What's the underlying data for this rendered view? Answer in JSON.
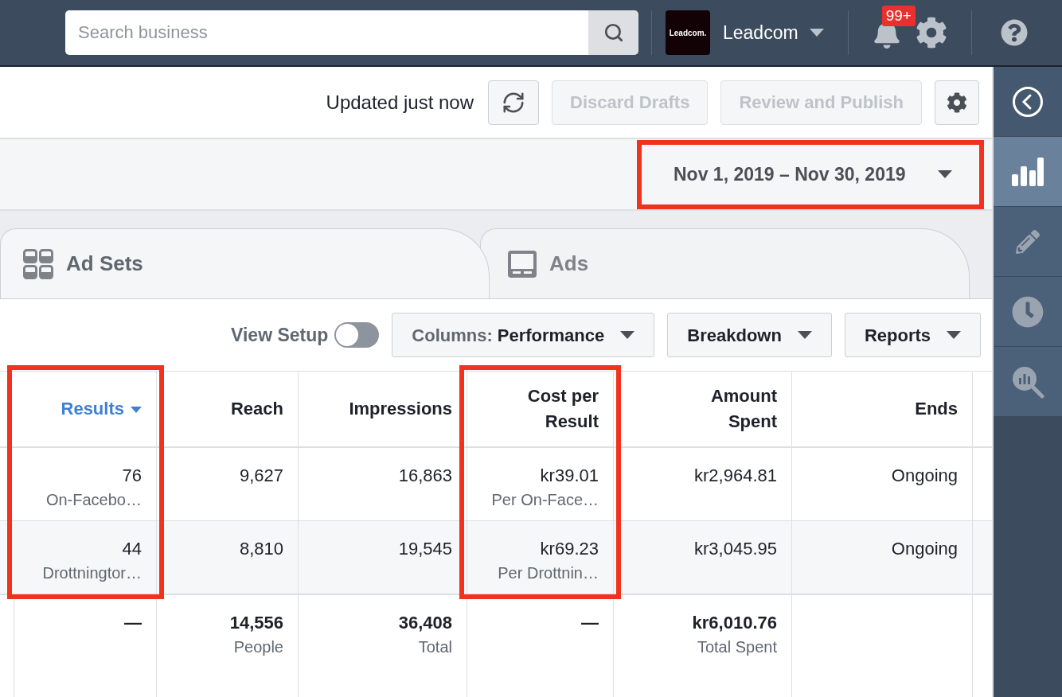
{
  "top_bar": {
    "search": {
      "placeholder": "Search business"
    },
    "account": {
      "logo_text": "Leadcom.",
      "name": "Leadcom"
    },
    "notifications": {
      "badge": "99+"
    }
  },
  "toolbar": {
    "status": "Updated just now",
    "buttons": [
      {
        "label": "Discard Drafts",
        "disabled": true
      },
      {
        "label": "Review and Publish",
        "disabled": true
      }
    ]
  },
  "date_range": {
    "label": "Nov 1, 2019 – Nov 30, 2019"
  },
  "tabs": [
    {
      "label": "Ad Sets",
      "kind": "adsets",
      "selected": true
    },
    {
      "label": "Ads",
      "kind": "ads",
      "selected": false
    }
  ],
  "controls": {
    "view_setup": {
      "label": "View Setup",
      "on": false
    },
    "columns": {
      "label": "Columns:",
      "value": "Performance"
    },
    "dropdowns": [
      "Breakdown",
      "Reports"
    ]
  },
  "table": {
    "columns": [
      {
        "label": "Results",
        "sorted": true
      },
      {
        "label": "Reach",
        "sorted": false
      },
      {
        "label": "Impressions",
        "sorted": false
      },
      {
        "label": "Cost per Result",
        "sorted": false
      },
      {
        "label": "Amount Spent",
        "sorted": false
      },
      {
        "label": "Ends",
        "sorted": false
      }
    ],
    "rows": [
      {
        "cells": [
          {
            "value": "76",
            "sub": "On-Facebo…"
          },
          {
            "value": "9,627"
          },
          {
            "value": "16,863"
          },
          {
            "value": "kr39.01",
            "sub": "Per On-Face…"
          },
          {
            "value": "kr2,964.81"
          },
          {
            "value": "Ongoing"
          }
        ]
      },
      {
        "cells": [
          {
            "value": "44",
            "sub": "Drottningtor…"
          },
          {
            "value": "8,810"
          },
          {
            "value": "19,545"
          },
          {
            "value": "kr69.23",
            "sub": "Per Drottnin…"
          },
          {
            "value": "kr3,045.95"
          },
          {
            "value": "Ongoing"
          }
        ]
      }
    ],
    "totals": [
      {
        "value": "—"
      },
      {
        "value": "14,556",
        "sub": "People"
      },
      {
        "value": "36,408",
        "sub": "Total"
      },
      {
        "value": "—"
      },
      {
        "value": "kr6,010.76",
        "sub": "Total Spent"
      }
    ]
  },
  "sidebar": {
    "items": [
      {
        "kind": "back",
        "selected": false
      },
      {
        "kind": "chart",
        "selected": true
      },
      {
        "kind": "pencil",
        "selected": false
      },
      {
        "kind": "clock",
        "selected": false
      },
      {
        "kind": "inspect",
        "selected": false
      }
    ]
  }
}
